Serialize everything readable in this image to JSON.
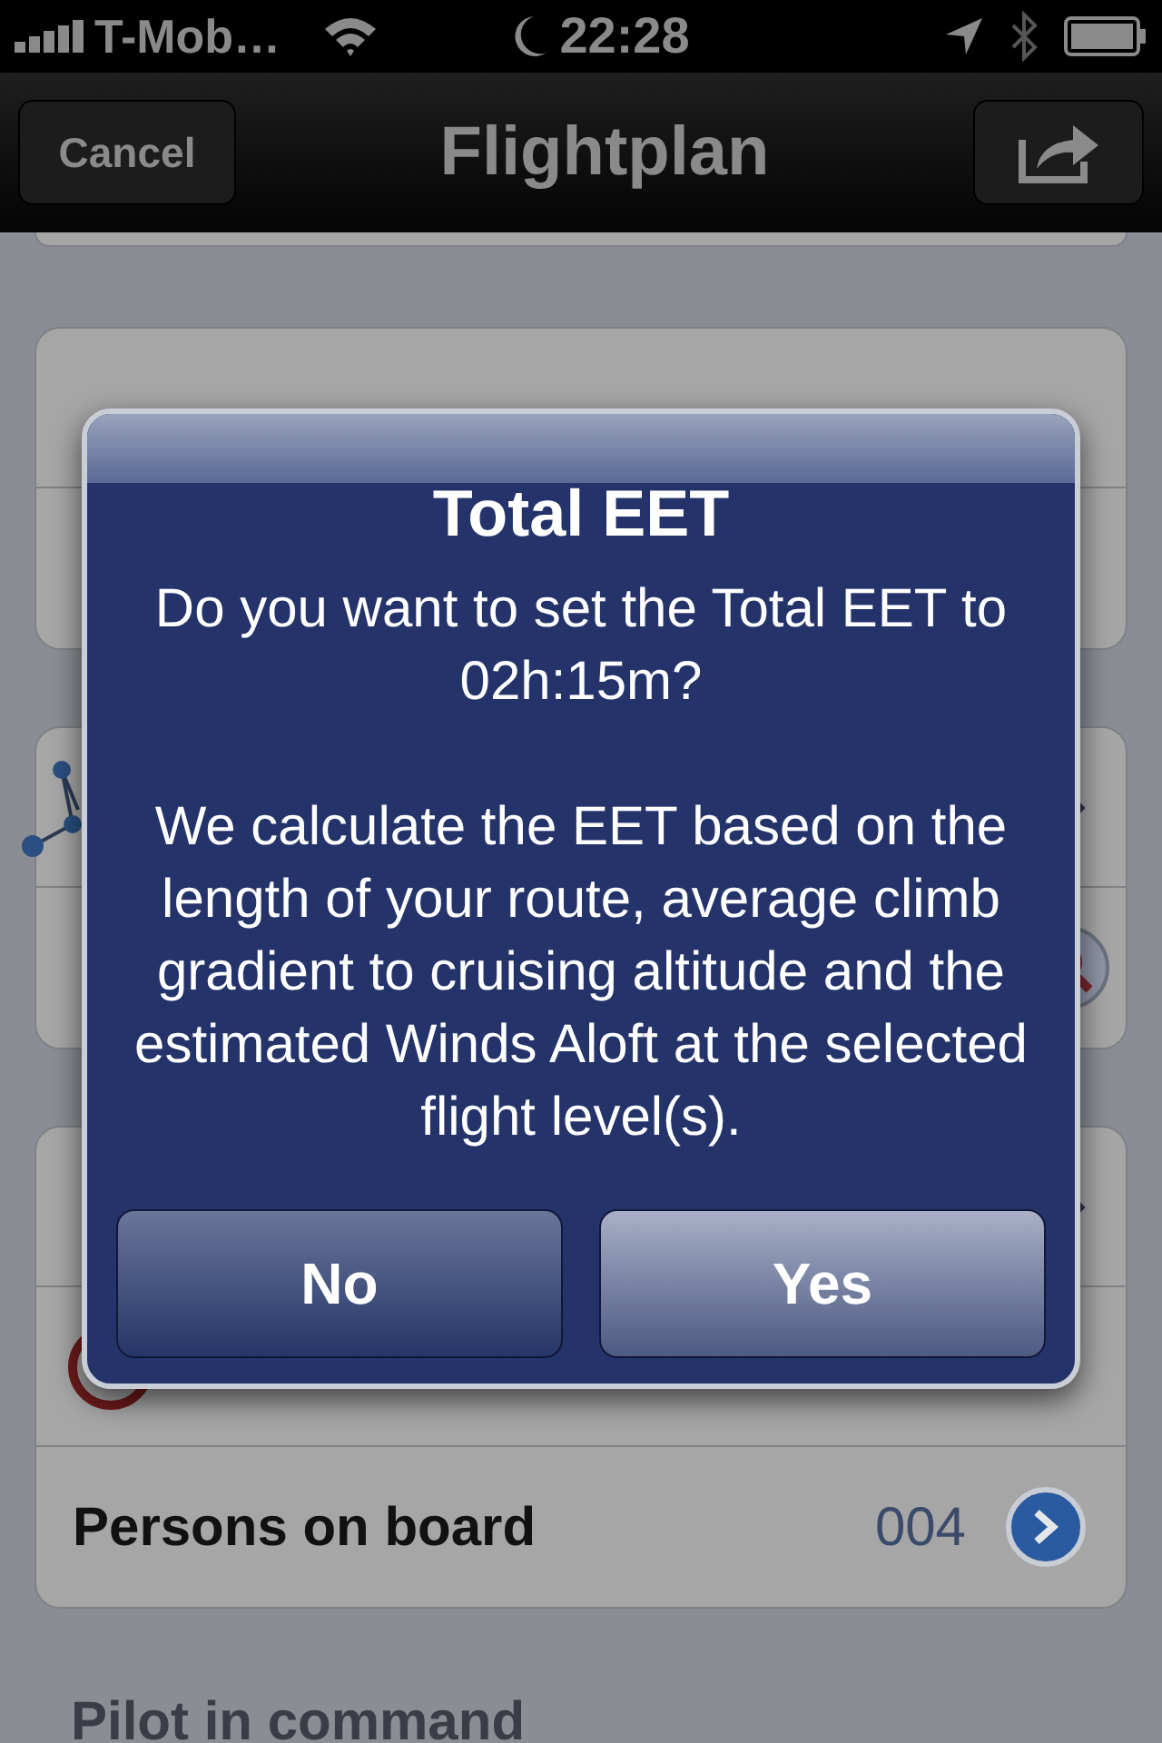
{
  "status_bar": {
    "carrier": "T-Mob…",
    "time": "22:28"
  },
  "nav_bar": {
    "cancel": "Cancel",
    "title": "Flightplan"
  },
  "sections": [
    {
      "rows": [
        {
          "kind": "value"
        },
        {
          "kind": "value"
        }
      ]
    },
    {
      "rows": [
        {
          "kind": "route"
        },
        {
          "kind": "search"
        }
      ]
    },
    {
      "rows": [
        {
          "kind": "link"
        },
        {
          "kind": "timer"
        },
        {
          "kind": "detail",
          "label": "Persons on board",
          "value": "004"
        }
      ]
    }
  ],
  "header": "Pilot in command",
  "alert": {
    "title": "Total EET",
    "message": [
      "Do you want to set the Total EET to 02h:15m?",
      "We calculate the EET based on the length of your route, average climb gradient to cruising altitude and the estimated Winds Aloft at the selected flight level(s)."
    ],
    "buttons": [
      {
        "label": "No",
        "kind": "cancel"
      },
      {
        "label": "Yes",
        "kind": "default"
      }
    ]
  }
}
